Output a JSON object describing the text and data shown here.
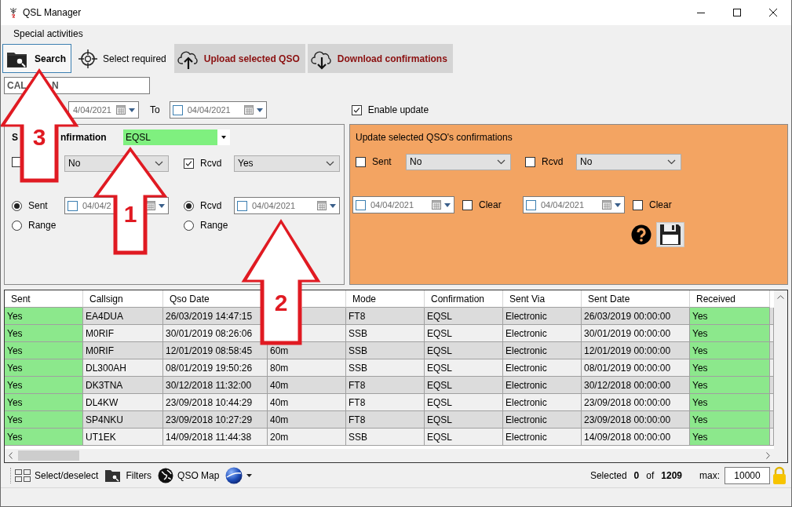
{
  "window": {
    "title": "QSL Manager"
  },
  "menu": [
    "Special activities"
  ],
  "toolbar": [
    {
      "label": "Search",
      "kind": "search",
      "focused": true
    },
    {
      "label": "Select required",
      "kind": "target",
      "focused": false
    },
    {
      "label": "Upload selected QSO",
      "kind": "upload",
      "focused": false
    },
    {
      "label": "Download confirmations",
      "kind": "download",
      "focused": false
    }
  ],
  "callsign": {
    "visible_parts": [
      "CAL",
      "N"
    ]
  },
  "date_range": {
    "from": {
      "value": "4/04/2021"
    },
    "to_label": "To",
    "to": {
      "checked": false,
      "value": "04/04/2021"
    }
  },
  "enable_update": {
    "label": "Enable update",
    "checked": true
  },
  "search_panel": {
    "title_parts": [
      "S",
      "nfirmation"
    ],
    "confirmation": "EQSL",
    "sent": {
      "checked": false,
      "value": "No"
    },
    "rcvd": {
      "label": "Rcvd",
      "checked": true,
      "value": "Yes"
    },
    "sent_mode": [
      {
        "label": "Sent",
        "selected": true
      },
      {
        "label": "Range",
        "selected": false
      }
    ],
    "sent_date": {
      "checked": false,
      "value": "04/04/2"
    },
    "rcvd_mode": [
      {
        "label": "Rcvd",
        "selected": true
      },
      {
        "label": "Range",
        "selected": false
      }
    ],
    "rcvd_date": {
      "checked": false,
      "value": "04/04/2021"
    }
  },
  "update_panel": {
    "title": "Update selected QSO's confirmations",
    "sent": {
      "label": "Sent",
      "checked": false,
      "value": "No"
    },
    "rcvd": {
      "label": "Rcvd",
      "checked": false,
      "value": "No"
    },
    "dates": [
      {
        "checked": false,
        "value": "04/04/2021",
        "clear_label": "Clear",
        "clear": false
      },
      {
        "checked": false,
        "value": "04/04/2021",
        "clear_label": "Clear",
        "clear": false
      }
    ]
  },
  "table": {
    "columns": [
      {
        "label": "Sent",
        "highlight": true
      },
      {
        "label": "Callsign"
      },
      {
        "label": "Qso Date"
      },
      {},
      {
        "label": "Mode"
      },
      {
        "label": "Confirmation"
      },
      {
        "label": "Sent Via"
      },
      {
        "label": "Sent Date"
      },
      {
        "label": "Received",
        "highlight": true
      }
    ],
    "rows": [
      [
        "Yes",
        "EA4DUA",
        "26/03/2019 14:47:15",
        null,
        "FT8",
        "EQSL",
        "Electronic",
        "26/03/2019 00:00:00",
        "Yes"
      ],
      [
        "Yes",
        "M0RIF",
        "30/01/2019 08:26:06",
        null,
        "SSB",
        "EQSL",
        "Electronic",
        "30/01/2019 00:00:00",
        "Yes"
      ],
      [
        "Yes",
        "M0RIF",
        "12/01/2019 08:58:45",
        "60m",
        "SSB",
        "EQSL",
        "Electronic",
        "12/01/2019 00:00:00",
        "Yes"
      ],
      [
        "Yes",
        "DL300AH",
        "08/01/2019 19:50:26",
        "80m",
        "SSB",
        "EQSL",
        "Electronic",
        "08/01/2019 00:00:00",
        "Yes"
      ],
      [
        "Yes",
        "DK3TNA",
        "30/12/2018 11:32:00",
        "40m",
        "FT8",
        "EQSL",
        "Electronic",
        "30/12/2018 00:00:00",
        "Yes"
      ],
      [
        "Yes",
        "DL4KW",
        "23/09/2018 10:44:29",
        "40m",
        "FT8",
        "EQSL",
        "Electronic",
        "23/09/2018 00:00:00",
        "Yes"
      ],
      [
        "Yes",
        "SP4NKU",
        "23/09/2018 10:27:29",
        "40m",
        "FT8",
        "EQSL",
        "Electronic",
        "23/09/2018 00:00:00",
        "Yes"
      ],
      [
        "Yes",
        "UT1EK",
        "14/09/2018 11:44:38",
        "20m",
        "SSB",
        "EQSL",
        "Electronic",
        "14/09/2018 00:00:00",
        "Yes"
      ]
    ]
  },
  "status_bar": {
    "tools": [
      {
        "label": "Select/deselect",
        "kind": "grid"
      },
      {
        "label": "Filters",
        "kind": "folder"
      },
      {
        "label": "QSO Map",
        "kind": "globe"
      },
      {
        "kind": "earth"
      }
    ],
    "selected_label": "Selected",
    "selected": "0",
    "of": "of",
    "total": "1209",
    "max_label": "max:",
    "max": "10000"
  },
  "annotations": [
    {
      "label": "3"
    },
    {
      "label": "1"
    },
    {
      "label": "2"
    }
  ]
}
